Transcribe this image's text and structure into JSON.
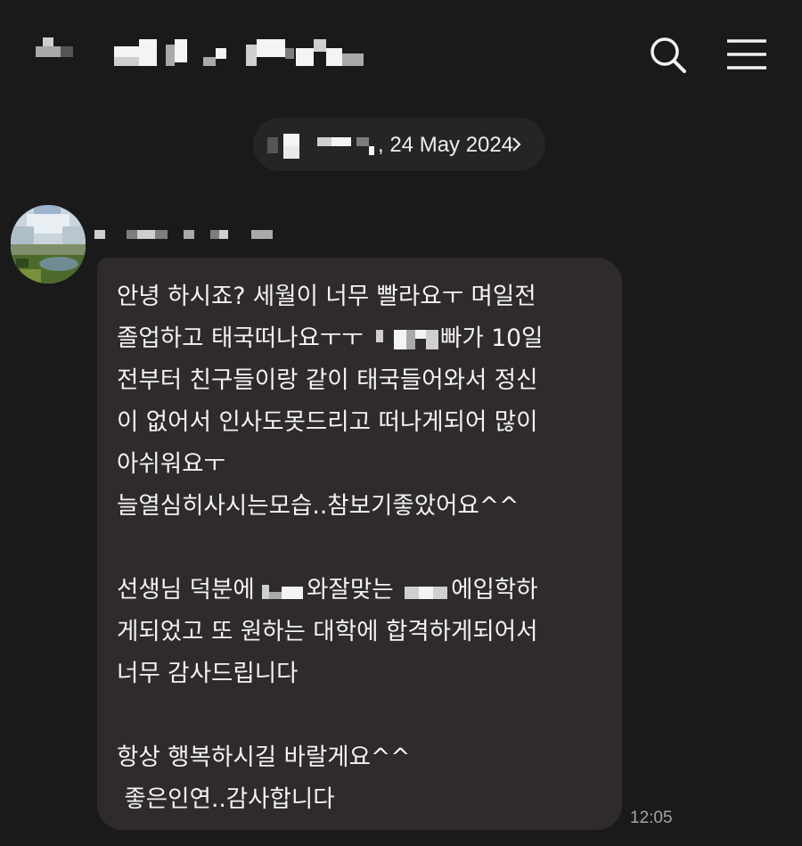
{
  "header": {
    "back_icon": "back-arrow-icon",
    "title": "",
    "search_icon": "search-icon",
    "menu_icon": "hamburger-menu-icon"
  },
  "date_divider": {
    "text": ", 24 May 2024",
    "chevron_icon": "chevron-right-icon"
  },
  "message": {
    "sender_name": "",
    "avatar": "avatar-landscape-photo",
    "time": "12:05",
    "lines": [
      "안녕 하시죠? 세월이 너무 빨라요ㅜ 며일전",
      "졸업하고 태국떠나요ㅜㅜ",
      "빠가 10일",
      "전부터 친구들이랑 같이 태국들어와서 정신",
      "이 없어서 인사도못드리고 떠나게되어 많이",
      "아쉬워요ㅜ",
      "늘열심히사시는모습..참보기좋았어요^^",
      "선생님 덕분에",
      "와잘맞는",
      "에입학하",
      "게되었고 또 원하는 대학에 합격하게되어서",
      "너무 감사드립니다",
      "항상 행복하시길 바랄게요^^",
      " 좋은인연..감사합니다"
    ]
  },
  "colors": {
    "background": "#1b1a1b",
    "bubble": "#2e2a2d",
    "date_pill": "#262426",
    "text": "#f3f3f3",
    "timestamp": "#a3a3a3"
  }
}
